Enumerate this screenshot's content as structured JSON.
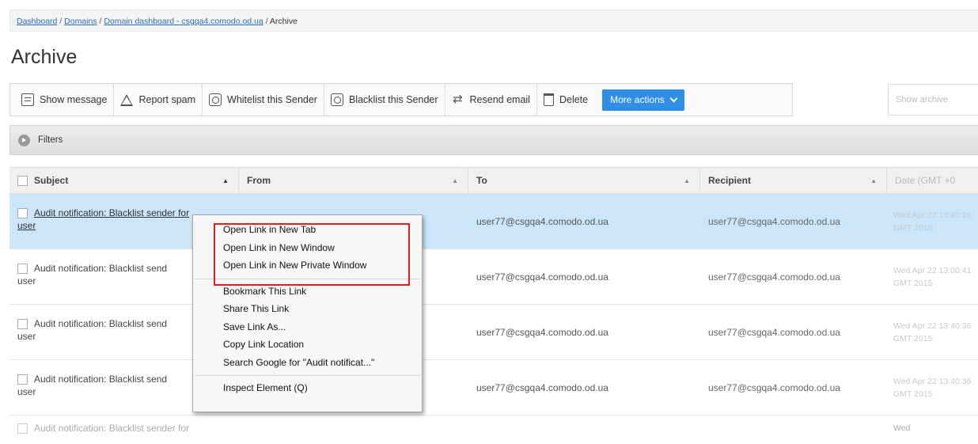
{
  "breadcrumb": {
    "dashboard": "Dashboard",
    "domains": "Domains",
    "domain_dashboard": "Domain dashboard - csgqa4.comodo.od.ua",
    "current": "Archive",
    "sep": " / "
  },
  "page_title": "Archive",
  "toolbar": {
    "show_message": "Show message",
    "report_spam": "Report spam",
    "whitelist": "Whitelist this Sender",
    "blacklist": "Blacklist this Sender",
    "resend": "Resend email",
    "delete": "Delete",
    "more_actions": "More actions"
  },
  "search": {
    "placeholder": "Show archive"
  },
  "filters": {
    "label": "Filters"
  },
  "table": {
    "headers": {
      "subject": "Subject",
      "from": "From",
      "to": "To",
      "recipient": "Recipient",
      "date": "Date (GMT +0"
    },
    "rows": [
      {
        "subject_line1": "Audit notification: Blacklist sender for",
        "subject_line2": "user",
        "to": "user77@csgqa4.comodo.od.ua",
        "recipient": "user77@csgqa4.comodo.od.ua",
        "date": "Wed Apr 22 13:40:16 GMT 2015"
      },
      {
        "subject_line1": "Audit notification: Blacklist send",
        "subject_line2": "user",
        "to": "user77@csgqa4.comodo.od.ua",
        "recipient": "user77@csgqa4.comodo.od.ua",
        "date": "Wed Apr 22 13:00:41 GMT 2015"
      },
      {
        "subject_line1": "Audit notification: Blacklist send",
        "subject_line2": "user",
        "to": "user77@csgqa4.comodo.od.ua",
        "recipient": "user77@csgqa4.comodo.od.ua",
        "date": "Wed Apr 22 13:40:36 GMT 2015"
      },
      {
        "subject_line1": "Audit notification: Blacklist send",
        "subject_line2": "user",
        "to": "user77@csgqa4.comodo.od.ua",
        "recipient": "user77@csgqa4.comodo.od.ua",
        "date": "Wed Apr 22 13:40:36 GMT 2015"
      },
      {
        "subject_line1": "Audit notification: Blacklist sender for",
        "subject_line2": "",
        "to": "",
        "recipient": "",
        "date": "Wed"
      }
    ]
  },
  "context_menu": {
    "items": [
      "Open Link in New Tab",
      "Open Link in New Window",
      "Open Link in New Private Window",
      "Bookmark This Link",
      "Share This Link",
      "Save Link As...",
      "Copy Link Location",
      "Search Google for \"Audit notificat...\"",
      "Inspect Element (Q)"
    ]
  },
  "colors": {
    "accent": "#2f8ee6",
    "selected_row": "#cbe6fb",
    "highlight_box": "#e21b1b"
  },
  "icons": {
    "show_message": "message-icon",
    "report_spam": "warning-icon",
    "whitelist": "shield-icon",
    "blacklist": "shield-icon",
    "resend": "resend-icon",
    "delete": "trash-icon",
    "filters": "expand-arrow-icon",
    "more_actions": "chevron-down-icon"
  }
}
